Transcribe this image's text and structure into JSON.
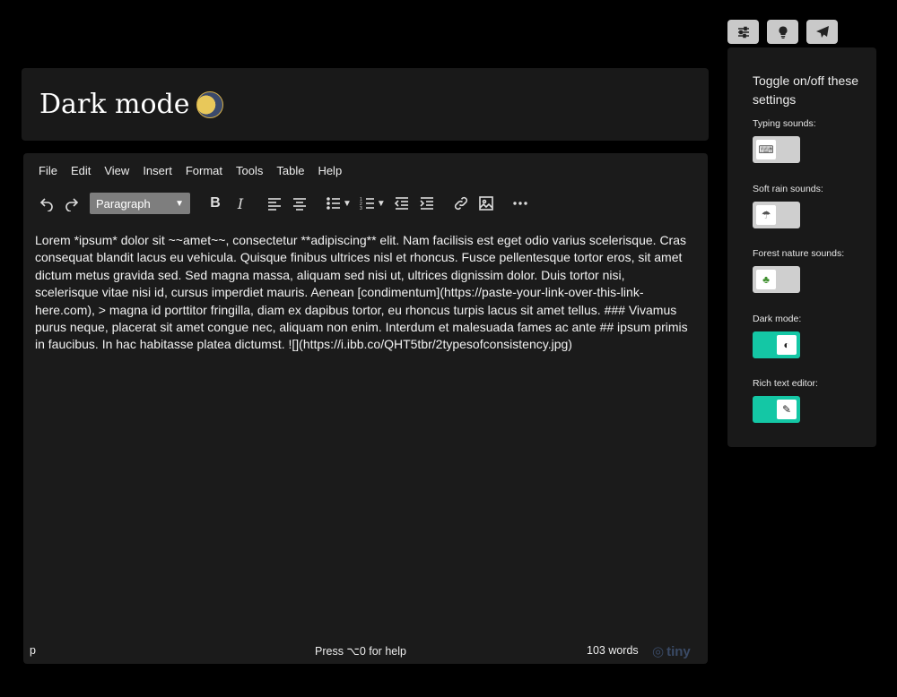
{
  "title": "Dark mode",
  "menu": [
    "File",
    "Edit",
    "View",
    "Insert",
    "Format",
    "Tools",
    "Table",
    "Help"
  ],
  "block_format": "Paragraph",
  "content": "Lorem *ipsum* dolor sit ~~amet~~, consectetur **adipiscing** elit. Nam facilisis est eget odio varius scelerisque. Cras consequat blandit lacus eu vehicula. Quisque finibus ultrices nisl et rhoncus. Fusce pellentesque tortor eros, sit amet dictum metus gravida sed. Sed magna massa, aliquam sed nisi ut, ultrices dignissim dolor. Duis tortor nisi, scelerisque vitae nisi id, cursus imperdiet mauris. Aenean [condimentum](https://paste-your-link-over-this-link-here.com), > magna id porttitor fringilla, diam ex dapibus tortor, eu rhoncus turpis lacus sit amet tellus. ### Vivamus purus neque, placerat sit amet congue nec, aliquam non enim. Interdum et malesuada fames ac ante ## ipsum primis in faucibus. In hac habitasse platea dictumst. ![](https://i.ibb.co/QHT5tbr/2typesofconsistency.jpg)",
  "status": {
    "path": "p",
    "help": "Press ⌥0 for help",
    "word_count": "103 words",
    "brand": "tiny"
  },
  "panel": {
    "title": "Toggle on/off these settings",
    "settings": [
      {
        "label": "Typing sounds:",
        "on": false,
        "icon": "keyboard-icon"
      },
      {
        "label": "Soft rain sounds:",
        "on": false,
        "icon": "rain-icon"
      },
      {
        "label": "Forest nature sounds:",
        "on": false,
        "icon": "tree-icon"
      },
      {
        "label": "Dark mode:",
        "on": true,
        "icon": "contrast-icon"
      },
      {
        "label": "Rich text editor:",
        "on": true,
        "icon": "pen-icon"
      }
    ]
  },
  "colors": {
    "accent": "#14c7a5",
    "background": "#000000",
    "card": "#191919"
  }
}
